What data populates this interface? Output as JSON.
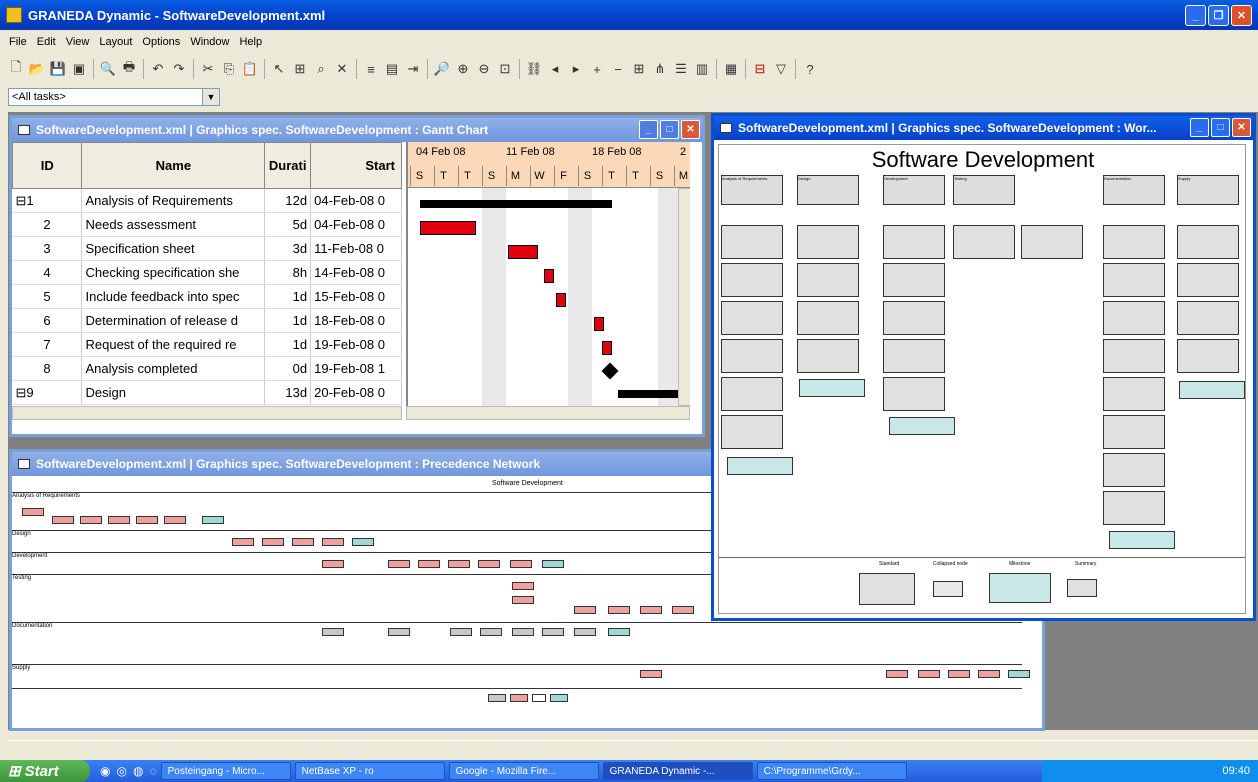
{
  "app": {
    "title": "GRANEDA Dynamic - SoftwareDevelopment.xml"
  },
  "menu": [
    "File",
    "Edit",
    "View",
    "Layout",
    "Options",
    "Window",
    "Help"
  ],
  "filter": {
    "value": "<All tasks>"
  },
  "gantt": {
    "title": "SoftwareDevelopment.xml | Graphics spec. SoftwareDevelopment : Gantt Chart",
    "headers": {
      "id": "ID",
      "name": "Name",
      "duration": "Durati",
      "start": "Start"
    },
    "weeks": [
      "04 Feb 08",
      "11 Feb 08",
      "18 Feb 08",
      "2"
    ],
    "days": [
      "S",
      "T",
      "T",
      "S",
      "M",
      "W",
      "F",
      "S",
      "T",
      "T",
      "S",
      "M"
    ],
    "rows": [
      {
        "id": "1",
        "name": "Analysis of Requirements",
        "dur": "12d",
        "start": "04-Feb-08 0",
        "group": true
      },
      {
        "id": "2",
        "name": "Needs assessment",
        "dur": "5d",
        "start": "04-Feb-08 0"
      },
      {
        "id": "3",
        "name": "Specification sheet",
        "dur": "3d",
        "start": "11-Feb-08 0"
      },
      {
        "id": "4",
        "name": "Checking specification she",
        "dur": "8h",
        "start": "14-Feb-08 0"
      },
      {
        "id": "5",
        "name": "Include feedback into spec",
        "dur": "1d",
        "start": "15-Feb-08 0"
      },
      {
        "id": "6",
        "name": "Determination of release d",
        "dur": "1d",
        "start": "18-Feb-08 0"
      },
      {
        "id": "7",
        "name": "Request of the required re",
        "dur": "1d",
        "start": "19-Feb-08 0"
      },
      {
        "id": "8",
        "name": "Analysis completed",
        "dur": "0d",
        "start": "19-Feb-08 1"
      },
      {
        "id": "9",
        "name": "Design",
        "dur": "13d",
        "start": "20-Feb-08 0",
        "group": true
      }
    ]
  },
  "wbs": {
    "title": "SoftwareDevelopment.xml | Graphics spec. SoftwareDevelopment : Wor...",
    "heading": "Software Development",
    "columns": [
      "Analysis of Requirements",
      "Design",
      "Development",
      "Testing",
      "Documentation",
      "Supply"
    ],
    "legend": [
      "Standard",
      "Collapsed node",
      "Milestone",
      "Summary"
    ]
  },
  "network": {
    "title": "SoftwareDevelopment.xml | Graphics spec. SoftwareDevelopment : Precedence Network",
    "heading": "Software Development",
    "lanes": [
      "Analysis of Requirements",
      "Design",
      "Development",
      "Testing",
      "Documentation",
      "Supply"
    ]
  },
  "taskbar": {
    "start": "Start",
    "tasks": [
      "Posteingang - Micro...",
      "NetBase XP - ro",
      "Google - Mozilla Fire...",
      "GRANEDA Dynamic -...",
      "C:\\Programme\\Grdy..."
    ],
    "clock": "09:40"
  }
}
